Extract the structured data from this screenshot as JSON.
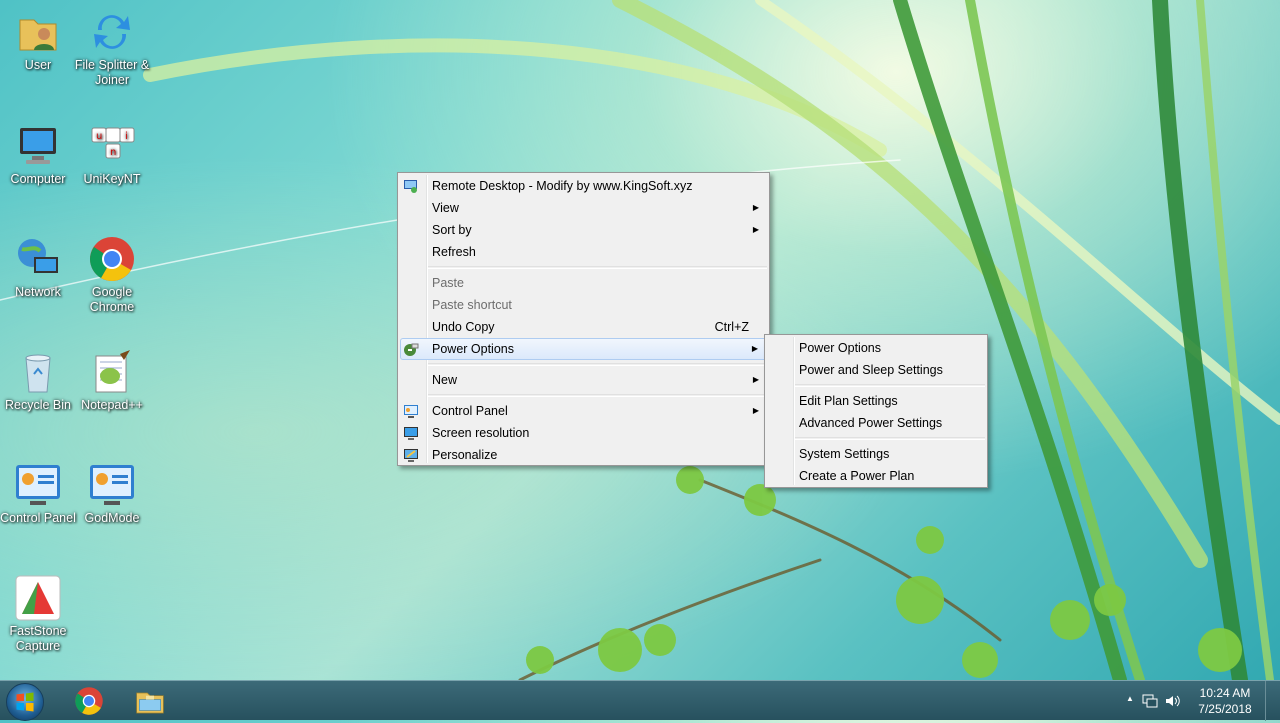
{
  "desktop_icons": [
    {
      "label": "User",
      "icon": "user-folder-icon"
    },
    {
      "label": "File Splitter & Joiner",
      "icon": "file-splitter-icon"
    },
    {
      "label": "Computer",
      "icon": "computer-icon"
    },
    {
      "label": "UniKeyNT",
      "icon": "unikey-icon"
    },
    {
      "label": "Network",
      "icon": "network-icon"
    },
    {
      "label": "Google Chrome",
      "icon": "chrome-icon"
    },
    {
      "label": "Recycle Bin",
      "icon": "recycle-bin-icon"
    },
    {
      "label": "Notepad++",
      "icon": "notepadpp-icon"
    },
    {
      "label": "Control Panel",
      "icon": "control-panel-icon"
    },
    {
      "label": "GodMode",
      "icon": "godmode-icon"
    },
    {
      "label": "FastStone Capture",
      "icon": "faststone-icon"
    }
  ],
  "context_menu": {
    "items": [
      {
        "label": "Remote Desktop - Modify by www.KingSoft.xyz",
        "icon": "remote-desktop-icon"
      },
      {
        "label": "View",
        "has_submenu": true
      },
      {
        "label": "Sort by",
        "has_submenu": true
      },
      {
        "label": "Refresh"
      },
      {
        "label": "Paste",
        "disabled": true
      },
      {
        "label": "Paste shortcut",
        "disabled": true
      },
      {
        "label": "Undo Copy",
        "shortcut": "Ctrl+Z"
      },
      {
        "label": "Power Options",
        "icon": "power-options-icon",
        "has_submenu": true,
        "highlighted": true
      },
      {
        "label": "New",
        "has_submenu": true
      },
      {
        "label": "Control Panel",
        "icon": "control-panel-icon",
        "has_submenu": true
      },
      {
        "label": "Screen resolution",
        "icon": "screen-resolution-icon"
      },
      {
        "label": "Personalize",
        "icon": "personalize-icon"
      }
    ],
    "arrow_glyph": "▶"
  },
  "power_submenu": {
    "items": [
      {
        "label": "Power Options"
      },
      {
        "label": "Power and Sleep Settings"
      },
      {
        "label": "Edit Plan Settings"
      },
      {
        "label": "Advanced Power Settings"
      },
      {
        "label": "System Settings"
      },
      {
        "label": "Create a Power Plan"
      }
    ]
  },
  "taskbar": {
    "pinned": [
      "start-button",
      "chrome-icon",
      "file-explorer-icon"
    ],
    "tray": {
      "overflow_glyph": "▲",
      "time": "10:24 AM",
      "date": "7/25/2018"
    }
  },
  "colors": {
    "menu_bg": "#f0f0f0",
    "menu_highlight": "#dbe9fb",
    "taskbar": "#27515e"
  }
}
